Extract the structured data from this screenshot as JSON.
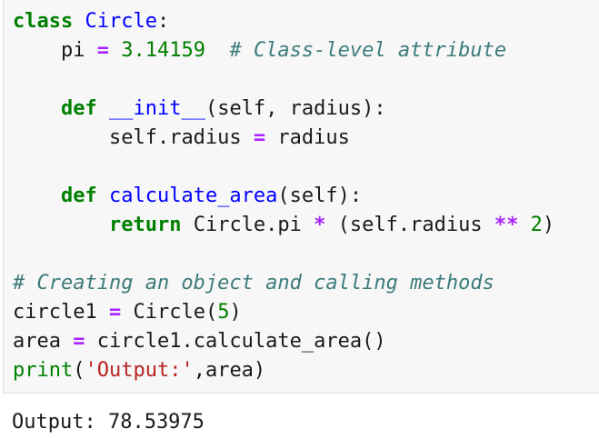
{
  "code_cell": {
    "line1": {
      "kw": "class",
      "sp": " ",
      "name": "Circle",
      "colon": ":"
    },
    "line2": {
      "indent": "    ",
      "var": "pi",
      "sp1": " ",
      "op": "=",
      "sp2": " ",
      "num": "3.14159",
      "sp3": "  ",
      "comment": "# Class-level attribute"
    },
    "line4": {
      "indent": "    ",
      "kw": "def",
      "sp": " ",
      "name": "__init__",
      "args": "(self, radius):"
    },
    "line5": {
      "indent": "        ",
      "lhs": "self.radius",
      "sp1": " ",
      "op": "=",
      "sp2": " ",
      "rhs": "radius"
    },
    "line7": {
      "indent": "    ",
      "kw": "def",
      "sp": " ",
      "name": "calculate_area",
      "args": "(self):"
    },
    "line8": {
      "indent": "        ",
      "kw": "return",
      "sp": " ",
      "expr1": "Circle.pi ",
      "op1": "*",
      "expr2": " (self.radius ",
      "op2": "**",
      "sp2": " ",
      "num": "2",
      "close": ")"
    },
    "line10": {
      "comment": "# Creating an object and calling methods"
    },
    "line11": {
      "var": "circle1",
      "sp1": " ",
      "op": "=",
      "sp2": " ",
      "call": "Circle(",
      "num": "5",
      "close": ")"
    },
    "line12": {
      "var": "area",
      "sp1": " ",
      "op": "=",
      "sp2": " ",
      "call": "circle1.calculate_area()"
    },
    "line13": {
      "fn": "print",
      "open": "(",
      "str": "'Output:'",
      "rest": ",area)"
    }
  },
  "output": {
    "text": "Output: 78.53975"
  }
}
